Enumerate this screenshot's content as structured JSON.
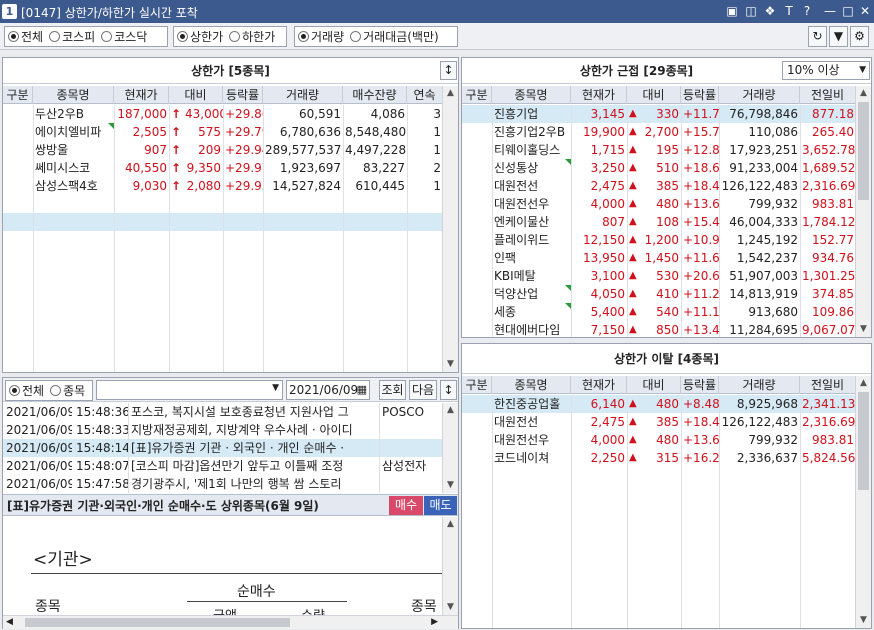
{
  "title": {
    "window_num": "1",
    "text": "[0147] 상한가/하한가 실시간 포착"
  },
  "filters": {
    "market": [
      "전체",
      "코스피",
      "코스닥"
    ],
    "limit": [
      "상한가",
      "하한가"
    ],
    "volume": [
      "거래량",
      "거래대금(백만)"
    ]
  },
  "left_panel": {
    "title": "상한가 [5종목]",
    "columns": [
      "구분",
      "종목명",
      "현재가",
      "대비",
      "등락률",
      "거래량",
      "매수잔량",
      "연속"
    ],
    "rows": [
      {
        "name": "두산2우B",
        "price": "187,000",
        "change": "43,000",
        "rate": "+29.86",
        "volume": "60,591",
        "bid": "4,086",
        "streak": "3",
        "mark": false
      },
      {
        "name": "에이치엘비파",
        "price": "2,505",
        "change": "575",
        "rate": "+29.79",
        "volume": "6,780,636",
        "bid": "8,548,480",
        "streak": "1",
        "mark": true
      },
      {
        "name": "쌍방울",
        "price": "907",
        "change": "209",
        "rate": "+29.94",
        "volume": "289,577,537",
        "bid": "4,497,228",
        "streak": "1",
        "mark": false
      },
      {
        "name": "쎄미시스코",
        "price": "40,550",
        "change": "9,350",
        "rate": "+29.97",
        "volume": "1,923,697",
        "bid": "83,227",
        "streak": "2",
        "mark": false
      },
      {
        "name": "삼성스팩4호",
        "price": "9,030",
        "change": "2,080",
        "rate": "+29.93",
        "volume": "14,527,824",
        "bid": "610,445",
        "streak": "1",
        "mark": false
      }
    ]
  },
  "near_panel": {
    "title": "상한가 근접 [29종목]",
    "dropdown": "10% 이상",
    "columns": [
      "구분",
      "종목명",
      "현재가",
      "대비",
      "등락률",
      "거래량",
      "전일비"
    ],
    "rows": [
      {
        "name": "진흥기업",
        "price": "3,145",
        "change": "330",
        "rate": "+11.72",
        "volume": "76,798,846",
        "prev": "877.18",
        "mark": false
      },
      {
        "name": "진흥기업2우B",
        "price": "19,900",
        "change": "2,700",
        "rate": "+15.70",
        "volume": "110,086",
        "prev": "265.40",
        "mark": false
      },
      {
        "name": "티웨이홀딩스",
        "price": "1,715",
        "change": "195",
        "rate": "+12.83",
        "volume": "17,923,251",
        "prev": "3,652.78",
        "mark": false
      },
      {
        "name": "신성통상",
        "price": "3,250",
        "change": "510",
        "rate": "+18.61",
        "volume": "91,233,004",
        "prev": "1,689.52",
        "mark": true
      },
      {
        "name": "대원전선",
        "price": "2,475",
        "change": "385",
        "rate": "+18.42",
        "volume": "126,122,483",
        "prev": "2,316.69",
        "mark": false
      },
      {
        "name": "대원전선우",
        "price": "4,000",
        "change": "480",
        "rate": "+13.64",
        "volume": "799,932",
        "prev": "983.81",
        "mark": false
      },
      {
        "name": "엔케이물산",
        "price": "807",
        "change": "108",
        "rate": "+15.45",
        "volume": "46,004,333",
        "prev": "1,784.12",
        "mark": false
      },
      {
        "name": "플레이위드",
        "price": "12,150",
        "change": "1,200",
        "rate": "+10.96",
        "volume": "1,245,192",
        "prev": "152.77",
        "mark": false
      },
      {
        "name": "인팩",
        "price": "13,950",
        "change": "1,450",
        "rate": "+11.60",
        "volume": "1,542,237",
        "prev": "934.76",
        "mark": false
      },
      {
        "name": "KBI메탈",
        "price": "3,100",
        "change": "530",
        "rate": "+20.62",
        "volume": "51,907,003",
        "prev": "1,301.25",
        "mark": false
      },
      {
        "name": "덕양산업",
        "price": "4,050",
        "change": "410",
        "rate": "+11.26",
        "volume": "14,813,919",
        "prev": "374.85",
        "mark": true
      },
      {
        "name": "세종",
        "price": "5,400",
        "change": "540",
        "rate": "+11.11",
        "volume": "913,680",
        "prev": "109.86",
        "mark": true
      },
      {
        "name": "현대에버다임",
        "price": "7,150",
        "change": "850",
        "rate": "+13.49",
        "volume": "11,284,695",
        "prev": "9,067.07",
        "mark": false
      }
    ]
  },
  "exit_panel": {
    "title": "상한가 이탈 [4종목]",
    "columns": [
      "구분",
      "종목명",
      "현재가",
      "대비",
      "등락률",
      "거래량",
      "전일비"
    ],
    "rows": [
      {
        "name": "한진중공업홀",
        "price": "6,140",
        "change": "480",
        "rate": "+8.48",
        "volume": "8,925,968",
        "prev": "2,341.13"
      },
      {
        "name": "대원전선",
        "price": "2,475",
        "change": "385",
        "rate": "+18.42",
        "volume": "126,122,483",
        "prev": "2,316.69"
      },
      {
        "name": "대원전선우",
        "price": "4,000",
        "change": "480",
        "rate": "+13.64",
        "volume": "799,932",
        "prev": "983.81"
      },
      {
        "name": "코드네이쳐",
        "price": "2,250",
        "change": "315",
        "rate": "+16.28",
        "volume": "2,336,637",
        "prev": "5,824.56"
      }
    ]
  },
  "news": {
    "radio": [
      "전체",
      "종목"
    ],
    "date": "2021/06/09",
    "search_label": "조회",
    "next_label": "다음",
    "rows": [
      {
        "date": "2021/06/09",
        "time": "15:48:36",
        "headline": "포스코, 복지시설 보호종료청년 지원사업 그",
        "stock": "POSCO"
      },
      {
        "date": "2021/06/09",
        "time": "15:48:33",
        "headline": "지방재정공제회, 지방계약 우수사례 · 아이디",
        "stock": ""
      },
      {
        "date": "2021/06/09",
        "time": "15:48:14",
        "headline": "[표]유가증권 기관 · 외국인 · 개인 순매수 ·",
        "stock": ""
      },
      {
        "date": "2021/06/09",
        "time": "15:48:07",
        "headline": "[코스피 마감]옵션만기 앞두고 이틀째 조정",
        "stock": "삼성전자"
      },
      {
        "date": "2021/06/09",
        "time": "15:47:58",
        "headline": "경기광주시, '제1회 나만의 행복 쌈 스토리",
        "stock": ""
      }
    ],
    "detail_title": "[표]유가증권 기관·외국인·개인 순매수·도 상위종목(6월 9일)",
    "buy_label": "매수",
    "sell_label": "매도",
    "section": "<기관>",
    "net_buy": "순매수",
    "col_stock": "종목",
    "col_stock2": "종목",
    "sub1": "금액",
    "sub2": "수량"
  }
}
